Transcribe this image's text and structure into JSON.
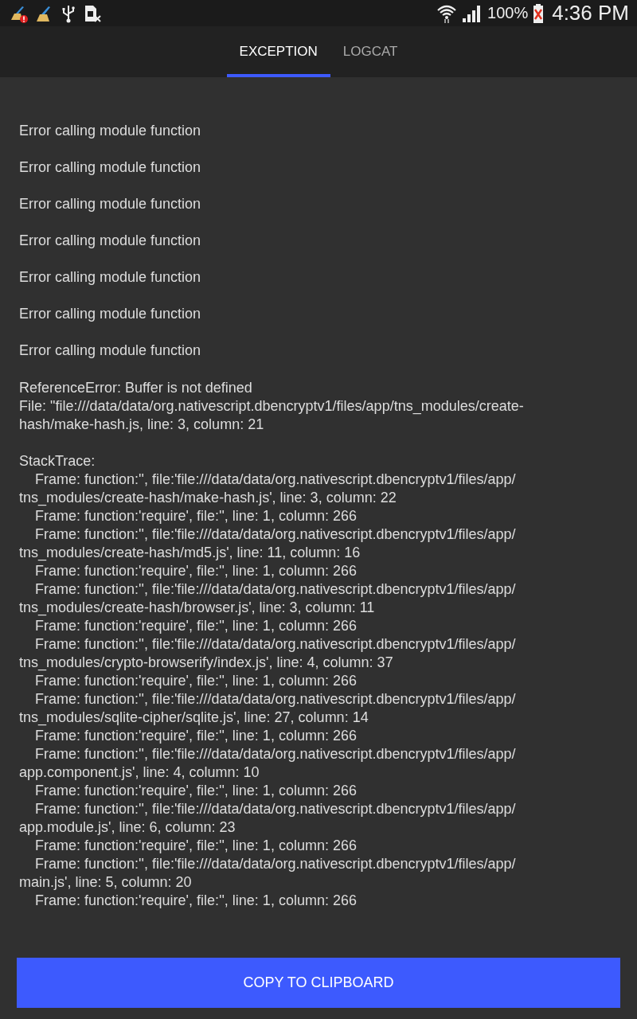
{
  "status_bar": {
    "battery": "100%",
    "time": "4:36 PM"
  },
  "tabs": [
    {
      "label": "EXCEPTION",
      "selected": true
    },
    {
      "label": "LOGCAT",
      "selected": false
    }
  ],
  "messages": [
    "Error calling module function",
    "Error calling module function",
    "Error calling module function",
    "Error calling module function",
    "Error calling module function",
    "Error calling module function",
    "Error calling module function"
  ],
  "error": [
    {
      "kind": "line",
      "text": "ReferenceError: Buffer is not defined"
    },
    {
      "kind": "line",
      "text": "File: \"file:///data/data/org.nativescript.dbencryptv1/files/app/tns_modules/create-"
    },
    {
      "kind": "line",
      "text": "hash/make-hash.js, line: 3, column: 21"
    }
  ],
  "stack_trace": [
    {
      "kind": "heading",
      "text": "StackTrace:"
    },
    {
      "kind": "frame",
      "text": "Frame: function:'', file:'file:///data/data/org.nativescript.dbencryptv1/files/app/"
    },
    {
      "kind": "line",
      "text": "tns_modules/create-hash/make-hash.js', line: 3, column: 22"
    },
    {
      "kind": "frame",
      "text": "Frame: function:'require', file:'', line: 1, column: 266"
    },
    {
      "kind": "frame",
      "text": "Frame: function:'', file:'file:///data/data/org.nativescript.dbencryptv1/files/app/"
    },
    {
      "kind": "line",
      "text": "tns_modules/create-hash/md5.js', line: 11, column: 16"
    },
    {
      "kind": "frame",
      "text": "Frame: function:'require', file:'', line: 1, column: 266"
    },
    {
      "kind": "frame",
      "text": "Frame: function:'', file:'file:///data/data/org.nativescript.dbencryptv1/files/app/"
    },
    {
      "kind": "line",
      "text": "tns_modules/create-hash/browser.js', line: 3, column: 11"
    },
    {
      "kind": "frame",
      "text": "Frame: function:'require', file:'', line: 1, column: 266"
    },
    {
      "kind": "frame",
      "text": "Frame: function:'', file:'file:///data/data/org.nativescript.dbencryptv1/files/app/"
    },
    {
      "kind": "line",
      "text": "tns_modules/crypto-browserify/index.js', line: 4, column: 37"
    },
    {
      "kind": "frame",
      "text": "Frame: function:'require', file:'', line: 1, column: 266"
    },
    {
      "kind": "frame",
      "text": "Frame: function:'', file:'file:///data/data/org.nativescript.dbencryptv1/files/app/"
    },
    {
      "kind": "line",
      "text": "tns_modules/sqlite-cipher/sqlite.js', line: 27, column: 14"
    },
    {
      "kind": "frame",
      "text": "Frame: function:'require', file:'', line: 1, column: 266"
    },
    {
      "kind": "frame",
      "text": "Frame: function:'', file:'file:///data/data/org.nativescript.dbencryptv1/files/app/"
    },
    {
      "kind": "line",
      "text": "app.component.js', line: 4, column: 10"
    },
    {
      "kind": "frame",
      "text": "Frame: function:'require', file:'', line: 1, column: 266"
    },
    {
      "kind": "frame",
      "text": "Frame: function:'', file:'file:///data/data/org.nativescript.dbencryptv1/files/app/"
    },
    {
      "kind": "line",
      "text": "app.module.js', line: 6, column: 23"
    },
    {
      "kind": "frame",
      "text": "Frame: function:'require', file:'', line: 1, column: 266"
    },
    {
      "kind": "frame",
      "text": "Frame: function:'', file:'file:///data/data/org.nativescript.dbencryptv1/files/app/"
    },
    {
      "kind": "line",
      "text": "main.js', line: 5, column: 20"
    },
    {
      "kind": "frame",
      "text": "Frame: function:'require', file:'', line: 1, column: 266"
    }
  ],
  "button": "COPY TO CLIPBOARD"
}
